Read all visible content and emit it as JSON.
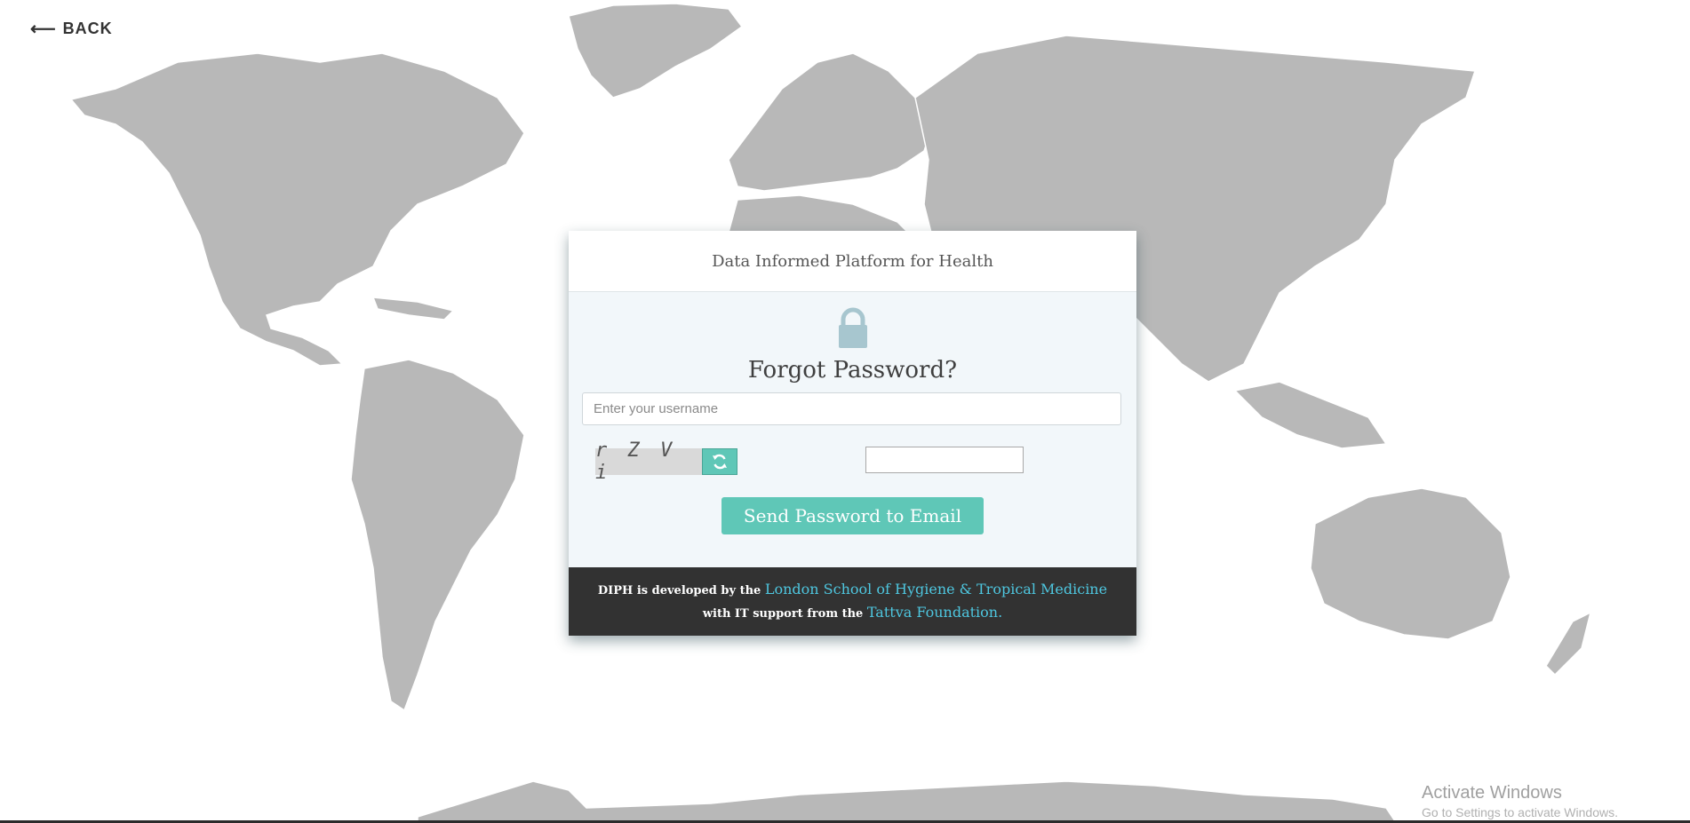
{
  "nav": {
    "back_label": "BACK",
    "back_icon": "left-arrow-icon"
  },
  "card": {
    "header": "Data Informed Platform for Health",
    "lock_icon": "lock-icon",
    "title": "Forgot Password?",
    "username_placeholder": "Enter your username",
    "captcha_text": "r Z V i",
    "refresh_icon": "refresh-icon",
    "send_button_label": "Send Password to Email",
    "footer": {
      "text_before": "DIPH is developed by the ",
      "link_lshtm": "London School of Hygiene & Tropical Medicine",
      "text_middle": " with IT support from the ",
      "link_tattva": "Tattva Foundation."
    }
  },
  "watermark": {
    "title": "Activate Windows",
    "subtitle": "Go to Settings to activate Windows."
  },
  "colors": {
    "accent": "#5fc7b7",
    "link": "#4ec6df",
    "footer_bg": "#323232",
    "map_land": "#b8b8b8",
    "lock": "#a7c6cf"
  }
}
